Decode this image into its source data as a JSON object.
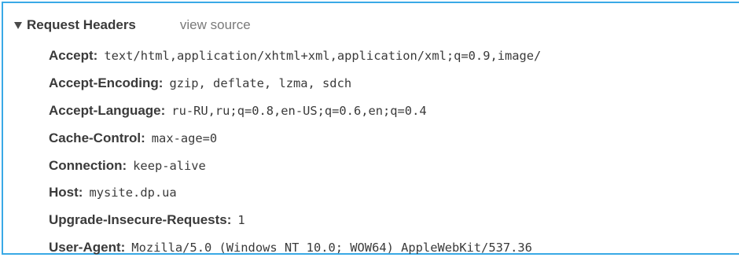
{
  "section": {
    "title": "Request Headers",
    "view_source_label": "view source",
    "expanded": true
  },
  "headers": [
    {
      "name": "Accept:",
      "value": "text/html,application/xhtml+xml,application/xml;q=0.9,image/"
    },
    {
      "name": "Accept-Encoding:",
      "value": "gzip, deflate, lzma, sdch"
    },
    {
      "name": "Accept-Language:",
      "value": "ru-RU,ru;q=0.8,en-US;q=0.6,en;q=0.4"
    },
    {
      "name": "Cache-Control:",
      "value": "max-age=0"
    },
    {
      "name": "Connection:",
      "value": "keep-alive"
    },
    {
      "name": "Host:",
      "value": "mysite.dp.ua"
    },
    {
      "name": "Upgrade-Insecure-Requests:",
      "value": "1"
    },
    {
      "name": "User-Agent:",
      "value": "Mozilla/5.0 (Windows NT 10.0; WOW64) AppleWebKit/537.36"
    }
  ],
  "colors": {
    "frame_border": "#39a9e6",
    "text": "#3a3a3a",
    "muted_link": "#7a7a7a"
  }
}
